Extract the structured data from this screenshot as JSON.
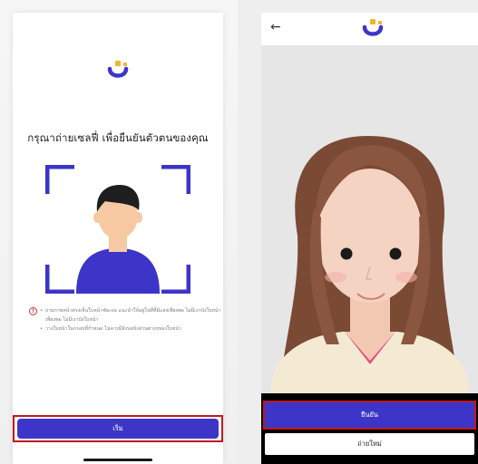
{
  "left_screen": {
    "title": "กรุณาถ่ายเซลฟี่ เพื่อยืนยันตัวตนของคุณ",
    "notes": [
      "ถ่ายภาพหน้าตรงเห็นใบหน้าชัดเจน แนะนำให้อยู่ในที่ที่มีแสงเพียงพอ ไม่มีเงาบังใบหน้า",
      "เพียงพอ ไม่มีเงาบังใบหน้า",
      "วางใบหน้าในกรอบที่กำหนด ไม่ควรมีสิ่งบดบังส่วนต่างๆของใบหน้า"
    ],
    "start_label": "เริ่ม"
  },
  "right_screen": {
    "back_label": "←",
    "confirm_label": "ยืนยัน",
    "retake_label": "ถ่ายใหม่"
  },
  "colors": {
    "brand_primary": "#3d35c8",
    "logo_accent": "#f2b533",
    "highlight": "#c0181e",
    "warning": "#d0342c"
  }
}
